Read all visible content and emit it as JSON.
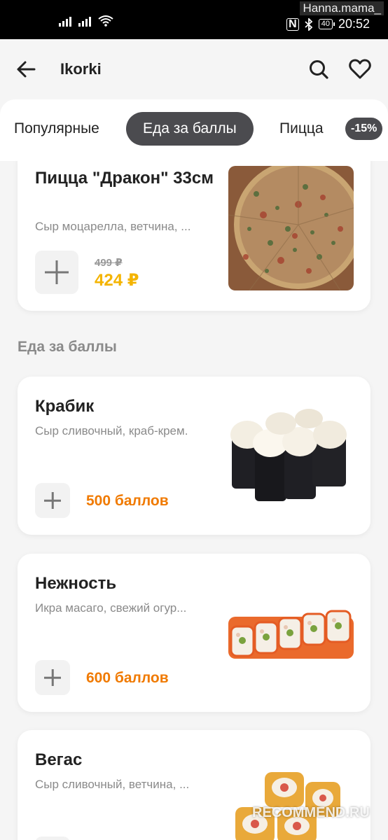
{
  "status_bar": {
    "time": "20:52",
    "battery": "40",
    "overlay_text": "Hanna.mama_"
  },
  "header": {
    "title": "Ikorki"
  },
  "tabs": [
    {
      "label": "Популярные",
      "active": false
    },
    {
      "label": "Еда за баллы",
      "active": true
    },
    {
      "label": "Пицца",
      "active": false
    }
  ],
  "discount_badge": "-15%",
  "items": [
    {
      "name": "Пицца \"Дракон\" 33см",
      "description": "Сыр моцарелла, ветчина, ...",
      "old_price": "499 ₽",
      "price": "424 ₽"
    },
    {
      "name": "Крабик",
      "description": "Сыр сливочный, краб-крем.",
      "points": "500 баллов"
    },
    {
      "name": "Нежность",
      "description": "Икра масаго, свежий огур...",
      "points": "600 баллов"
    },
    {
      "name": "Вегас",
      "description": "Сыр сливочный, ветчина, ..."
    }
  ],
  "section": {
    "title": "Еда за баллы"
  },
  "watermark": "RECOMMEND.RU",
  "colors": {
    "accent_dark": "#4b4b4f",
    "price_yellow": "#f4b400",
    "points_orange": "#f07a00"
  }
}
